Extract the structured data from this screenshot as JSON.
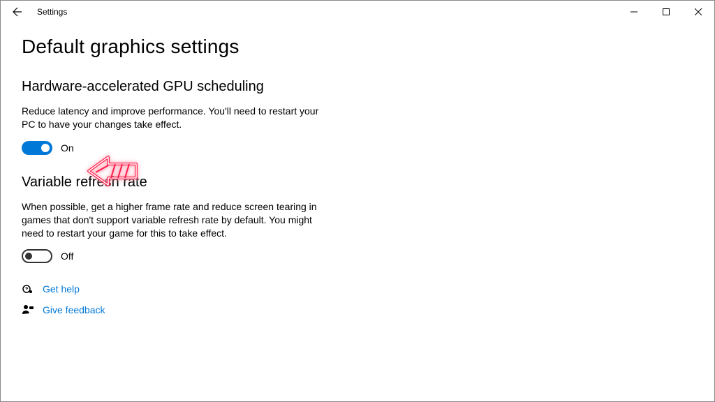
{
  "window": {
    "title": "Settings"
  },
  "page": {
    "title": "Default graphics settings"
  },
  "sections": {
    "gpu": {
      "title": "Hardware-accelerated GPU scheduling",
      "description": "Reduce latency and improve performance. You'll need to restart your PC to have your changes take effect.",
      "toggle_state": "On"
    },
    "vrr": {
      "title": "Variable refresh rate",
      "description": "When possible, get a higher frame rate and reduce screen tearing in games that don't support variable refresh rate by default. You might need to restart your game for this to take effect.",
      "toggle_state": "Off"
    }
  },
  "links": {
    "help": "Get help",
    "feedback": "Give feedback"
  },
  "colors": {
    "accent": "#0078d7",
    "text": "#000000"
  }
}
